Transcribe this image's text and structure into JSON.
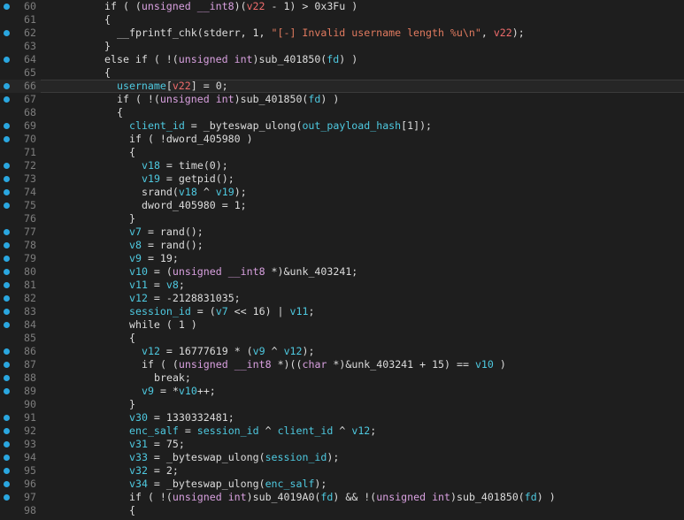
{
  "colors": {
    "background": "#1e1e1e",
    "line_number": "#7d7d7d",
    "breakpoint": "#2aa7e0",
    "identifier_highlight": "#4ec9e0",
    "type_keyword": "#d8a0df",
    "string": "#e07a5f",
    "local_var": "#ef6c6c"
  },
  "icons": {
    "breakpoint": "breakpoint-dot-icon"
  },
  "lines": [
    {
      "n": "60",
      "bp": true,
      "indent": 6,
      "tokens": [
        [
          "plain",
          "if ( ("
        ],
        [
          "type",
          "unsigned __int8"
        ],
        [
          "plain",
          ")("
        ],
        [
          "lvar",
          "v22"
        ],
        [
          "plain",
          " - 1) > 0x3Fu )"
        ]
      ]
    },
    {
      "n": "61",
      "bp": false,
      "indent": 6,
      "tokens": [
        [
          "plain",
          "{"
        ]
      ]
    },
    {
      "n": "62",
      "bp": true,
      "indent": 8,
      "tokens": [
        [
          "plain",
          "__fprintf_chk(stderr, 1, "
        ],
        [
          "str",
          "\"[-] Invalid username length %u\\n\""
        ],
        [
          "plain",
          ", "
        ],
        [
          "lvar",
          "v22"
        ],
        [
          "plain",
          ");"
        ]
      ]
    },
    {
      "n": "63",
      "bp": false,
      "indent": 6,
      "tokens": [
        [
          "plain",
          "}"
        ]
      ]
    },
    {
      "n": "64",
      "bp": true,
      "indent": 6,
      "tokens": [
        [
          "plain",
          "else if ( !("
        ],
        [
          "type",
          "unsigned int"
        ],
        [
          "plain",
          ")sub_401850("
        ],
        [
          "var",
          "fd"
        ],
        [
          "plain",
          ") )"
        ]
      ]
    },
    {
      "n": "65",
      "bp": false,
      "indent": 6,
      "tokens": [
        [
          "plain",
          "{"
        ]
      ]
    },
    {
      "n": "66",
      "bp": true,
      "indent": 8,
      "current": true,
      "tokens": [
        [
          "var",
          "username"
        ],
        [
          "plain",
          "["
        ],
        [
          "lvar",
          "v22"
        ],
        [
          "plain",
          "] = 0;"
        ]
      ]
    },
    {
      "n": "67",
      "bp": true,
      "indent": 8,
      "tokens": [
        [
          "plain",
          "if ( !("
        ],
        [
          "type",
          "unsigned int"
        ],
        [
          "plain",
          ")sub_401850("
        ],
        [
          "var",
          "fd"
        ],
        [
          "plain",
          ") )"
        ]
      ]
    },
    {
      "n": "68",
      "bp": false,
      "indent": 8,
      "tokens": [
        [
          "plain",
          "{"
        ]
      ]
    },
    {
      "n": "69",
      "bp": true,
      "indent": 10,
      "tokens": [
        [
          "var",
          "client_id"
        ],
        [
          "plain",
          " = _byteswap_ulong("
        ],
        [
          "var",
          "out_payload_hash"
        ],
        [
          "plain",
          "[1]);"
        ]
      ]
    },
    {
      "n": "70",
      "bp": true,
      "indent": 10,
      "tokens": [
        [
          "plain",
          "if ( !dword_405980 )"
        ]
      ]
    },
    {
      "n": "71",
      "bp": false,
      "indent": 10,
      "tokens": [
        [
          "plain",
          "{"
        ]
      ]
    },
    {
      "n": "72",
      "bp": true,
      "indent": 12,
      "tokens": [
        [
          "var",
          "v18"
        ],
        [
          "plain",
          " = time(0);"
        ]
      ]
    },
    {
      "n": "73",
      "bp": true,
      "indent": 12,
      "tokens": [
        [
          "var",
          "v19"
        ],
        [
          "plain",
          " = getpid();"
        ]
      ]
    },
    {
      "n": "74",
      "bp": true,
      "indent": 12,
      "tokens": [
        [
          "plain",
          "srand("
        ],
        [
          "var",
          "v18"
        ],
        [
          "plain",
          " ^ "
        ],
        [
          "var",
          "v19"
        ],
        [
          "plain",
          ");"
        ]
      ]
    },
    {
      "n": "75",
      "bp": true,
      "indent": 12,
      "tokens": [
        [
          "plain",
          "dword_405980 = 1;"
        ]
      ]
    },
    {
      "n": "76",
      "bp": false,
      "indent": 10,
      "tokens": [
        [
          "plain",
          "}"
        ]
      ]
    },
    {
      "n": "77",
      "bp": true,
      "indent": 10,
      "tokens": [
        [
          "var",
          "v7"
        ],
        [
          "plain",
          " = rand();"
        ]
      ]
    },
    {
      "n": "78",
      "bp": true,
      "indent": 10,
      "tokens": [
        [
          "var",
          "v8"
        ],
        [
          "plain",
          " = rand();"
        ]
      ]
    },
    {
      "n": "79",
      "bp": true,
      "indent": 10,
      "tokens": [
        [
          "var",
          "v9"
        ],
        [
          "plain",
          " = 19;"
        ]
      ]
    },
    {
      "n": "80",
      "bp": true,
      "indent": 10,
      "tokens": [
        [
          "var",
          "v10"
        ],
        [
          "plain",
          " = ("
        ],
        [
          "type",
          "unsigned __int8"
        ],
        [
          "plain",
          " *)&unk_403241;"
        ]
      ]
    },
    {
      "n": "81",
      "bp": true,
      "indent": 10,
      "tokens": [
        [
          "var",
          "v11"
        ],
        [
          "plain",
          " = "
        ],
        [
          "var",
          "v8"
        ],
        [
          "plain",
          ";"
        ]
      ]
    },
    {
      "n": "82",
      "bp": true,
      "indent": 10,
      "tokens": [
        [
          "var",
          "v12"
        ],
        [
          "plain",
          " = -2128831035;"
        ]
      ]
    },
    {
      "n": "83",
      "bp": true,
      "indent": 10,
      "tokens": [
        [
          "var",
          "session_id"
        ],
        [
          "plain",
          " = ("
        ],
        [
          "var",
          "v7"
        ],
        [
          "plain",
          " << 16) | "
        ],
        [
          "var",
          "v11"
        ],
        [
          "plain",
          ";"
        ]
      ]
    },
    {
      "n": "84",
      "bp": true,
      "indent": 10,
      "tokens": [
        [
          "plain",
          "while ( 1 )"
        ]
      ]
    },
    {
      "n": "85",
      "bp": false,
      "indent": 10,
      "tokens": [
        [
          "plain",
          "{"
        ]
      ]
    },
    {
      "n": "86",
      "bp": true,
      "indent": 12,
      "tokens": [
        [
          "var",
          "v12"
        ],
        [
          "plain",
          " = 16777619 * ("
        ],
        [
          "var",
          "v9"
        ],
        [
          "plain",
          " ^ "
        ],
        [
          "var",
          "v12"
        ],
        [
          "plain",
          ");"
        ]
      ]
    },
    {
      "n": "87",
      "bp": true,
      "indent": 12,
      "tokens": [
        [
          "plain",
          "if ( ("
        ],
        [
          "type",
          "unsigned __int8"
        ],
        [
          "plain",
          " *)(("
        ],
        [
          "type",
          "char"
        ],
        [
          "plain",
          " *)&unk_403241 + 15) == "
        ],
        [
          "var",
          "v10"
        ],
        [
          "plain",
          " )"
        ]
      ]
    },
    {
      "n": "88",
      "bp": true,
      "indent": 14,
      "tokens": [
        [
          "plain",
          "break;"
        ]
      ]
    },
    {
      "n": "89",
      "bp": true,
      "indent": 12,
      "tokens": [
        [
          "var",
          "v9"
        ],
        [
          "plain",
          " = *"
        ],
        [
          "var",
          "v10"
        ],
        [
          "plain",
          "++;"
        ]
      ]
    },
    {
      "n": "90",
      "bp": false,
      "indent": 10,
      "tokens": [
        [
          "plain",
          "}"
        ]
      ]
    },
    {
      "n": "91",
      "bp": true,
      "indent": 10,
      "tokens": [
        [
          "var",
          "v30"
        ],
        [
          "plain",
          " = 1330332481;"
        ]
      ]
    },
    {
      "n": "92",
      "bp": true,
      "indent": 10,
      "tokens": [
        [
          "var",
          "enc_salf"
        ],
        [
          "plain",
          " = "
        ],
        [
          "var",
          "session_id"
        ],
        [
          "plain",
          " ^ "
        ],
        [
          "var",
          "client_id"
        ],
        [
          "plain",
          " ^ "
        ],
        [
          "var",
          "v12"
        ],
        [
          "plain",
          ";"
        ]
      ]
    },
    {
      "n": "93",
      "bp": true,
      "indent": 10,
      "tokens": [
        [
          "var",
          "v31"
        ],
        [
          "plain",
          " = 75;"
        ]
      ]
    },
    {
      "n": "94",
      "bp": true,
      "indent": 10,
      "tokens": [
        [
          "var",
          "v33"
        ],
        [
          "plain",
          " = _byteswap_ulong("
        ],
        [
          "var",
          "session_id"
        ],
        [
          "plain",
          ");"
        ]
      ]
    },
    {
      "n": "95",
      "bp": true,
      "indent": 10,
      "tokens": [
        [
          "var",
          "v32"
        ],
        [
          "plain",
          " = 2;"
        ]
      ]
    },
    {
      "n": "96",
      "bp": true,
      "indent": 10,
      "tokens": [
        [
          "var",
          "v34"
        ],
        [
          "plain",
          " = _byteswap_ulong("
        ],
        [
          "var",
          "enc_salf"
        ],
        [
          "plain",
          ");"
        ]
      ]
    },
    {
      "n": "97",
      "bp": true,
      "indent": 10,
      "tokens": [
        [
          "plain",
          "if ( !("
        ],
        [
          "type",
          "unsigned int"
        ],
        [
          "plain",
          ")sub_4019A0("
        ],
        [
          "var",
          "fd"
        ],
        [
          "plain",
          ") && !("
        ],
        [
          "type",
          "unsigned int"
        ],
        [
          "plain",
          ")sub_401850("
        ],
        [
          "var",
          "fd"
        ],
        [
          "plain",
          ") )"
        ]
      ]
    },
    {
      "n": "98",
      "bp": false,
      "indent": 10,
      "tokens": [
        [
          "plain",
          "{"
        ]
      ]
    }
  ]
}
